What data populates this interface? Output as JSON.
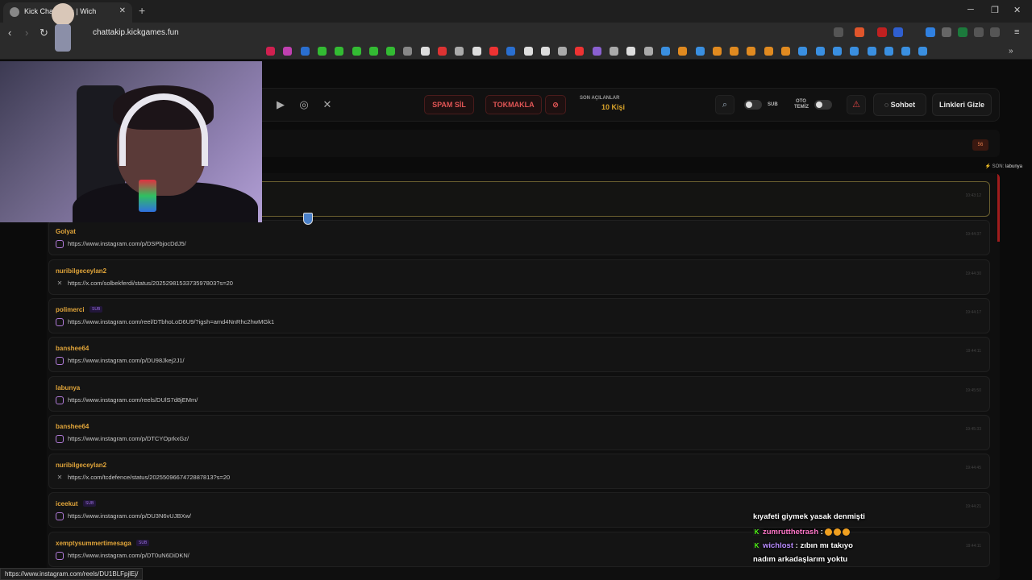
{
  "browser": {
    "tab_title": "Kick Chat Takip | Wich",
    "url": "chattakip.kickgames.fun",
    "status_url": "https://www.instagram.com/reels/DU1BLFpjlEj/"
  },
  "toolbar": {
    "spam_label": "SPAM SİL",
    "tokmakla_label": "TOKMAKLA",
    "last_opened_label": "SON AÇILANLAR",
    "last_opened_count": "10 Kişi",
    "sub_label": "SUB",
    "oto_label": "OTO",
    "temiz_label": "TEMİZ",
    "chat_label": "Sohbet",
    "hide_links_label": "Linkleri Gizle"
  },
  "header": {
    "count": "56",
    "last_prefix": "SON:",
    "last_user": "labunya"
  },
  "messages": [
    {
      "user": "",
      "link": "",
      "time": "10:43:12",
      "sub": "",
      "icon": ""
    },
    {
      "user": "Golyat",
      "link": "https://www.instagram.com/p/DSPbjocDdJ5/",
      "time": "19:44:37",
      "sub": "",
      "icon": "instagram"
    },
    {
      "user": "nuribilgeceylan2",
      "link": "https://x.com/solbekferdi/status/2025298153373597803?s=20",
      "time": "19:44:30",
      "sub": "",
      "icon": "x"
    },
    {
      "user": "polimerci",
      "link": "https://www.instagram.com/reel/DTbhoLoD6U9/?igsh=amd4NnRhc2hwMGk1",
      "time": "19:44:17",
      "sub": "SUB",
      "icon": "instagram"
    },
    {
      "user": "banshee64",
      "link": "https://www.instagram.com/p/DU98Jkej2J1/",
      "time": "19:44:11",
      "sub": "",
      "icon": "instagram"
    },
    {
      "user": "labunya",
      "link": "https://www.instagram.com/reels/DUlS7d8jEMm/",
      "time": "19:45:50",
      "sub": "",
      "icon": "instagram"
    },
    {
      "user": "banshee64",
      "link": "https://www.instagram.com/p/DTCYOprkxGz/",
      "time": "19:45:33",
      "sub": "",
      "icon": "instagram"
    },
    {
      "user": "nuribilgeceylan2",
      "link": "https://x.com/tcdefence/status/2025509667472887813?s=20",
      "time": "19:44:45",
      "sub": "",
      "icon": "x"
    },
    {
      "user": "iceekut",
      "link": "https://www.instagram.com/p/DU3N6vUJBXw/",
      "time": "19:44:21",
      "sub": "SUB",
      "icon": "instagram"
    },
    {
      "user": "xemptysummertimesaga",
      "link": "https://www.instagram.com/p/DT0uN6DiDKN/",
      "time": "19:44:11",
      "sub": "SUB",
      "icon": "instagram"
    }
  ],
  "chat_overlay": {
    "line1": "kıyafeti giymek yasak denmişti",
    "line2_user": "zumrutthetrash",
    "line2_text": ":",
    "line3_user": "wichlost",
    "line3_text": ": zıbın mı takıyo",
    "line4": "nadım arkadaşlarım yoktu"
  },
  "colors": {
    "accent_user": "#e1a53a",
    "danger": "#e05555",
    "kick_green": "#53fc18"
  }
}
